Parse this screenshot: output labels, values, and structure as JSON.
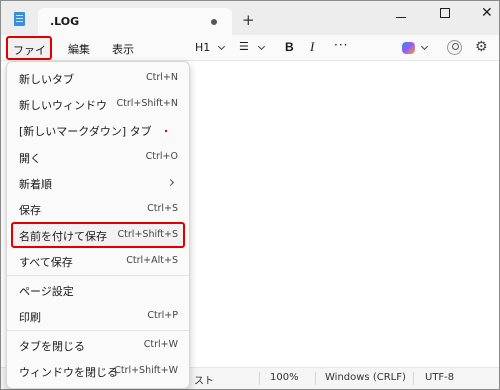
{
  "titlebar": {
    "tab_title": ".LOG",
    "new_tab_symbol": "+",
    "close_symbol": "✕"
  },
  "menubar": {
    "file": "ファイル",
    "edit": "編集",
    "view": "表示"
  },
  "toolbar": {
    "heading": "H1",
    "bold": "B",
    "italic": "I",
    "more": "···",
    "list_icon": "☰",
    "settings_icon": "⚙"
  },
  "file_menu": {
    "items": [
      {
        "label": "新しいタブ",
        "shortcut": "Ctrl+N"
      },
      {
        "label": "新しいウィンドウ",
        "shortcut": "Ctrl+Shift+N"
      },
      {
        "label": "[新しいマークダウン] タブ",
        "shortcut": ""
      },
      {
        "label": "開く",
        "shortcut": "Ctrl+O"
      },
      {
        "label": "新着順",
        "shortcut": ""
      },
      {
        "label": "保存",
        "shortcut": "Ctrl+S"
      },
      {
        "label": "名前を付けて保存",
        "shortcut": "Ctrl+Shift+S"
      },
      {
        "label": "すべて保存",
        "shortcut": "Ctrl+Alt+S"
      },
      {
        "label": "ページ設定",
        "shortcut": ""
      },
      {
        "label": "印刷",
        "shortcut": "Ctrl+P"
      },
      {
        "label": "タブを閉じる",
        "shortcut": "Ctrl+W"
      },
      {
        "label": "ウィンドウを閉じる",
        "shortcut": "Ctrl+Shift+W"
      }
    ]
  },
  "statusbar": {
    "partial": "スト",
    "zoom": "100%",
    "line_ending": "Windows (CRLF)",
    "encoding": "UTF-8"
  },
  "colors": {
    "highlight_border": "#e00000",
    "app_icon": "#3a8fd8"
  }
}
